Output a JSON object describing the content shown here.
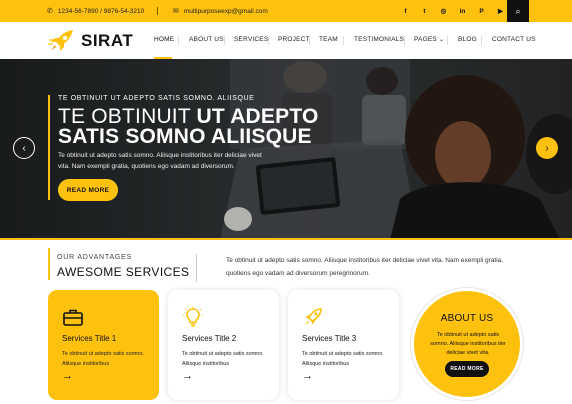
{
  "topbar": {
    "phone": "1234-56-7890 / 9876-54-3210",
    "email": "multipurposeexp@gmail.com",
    "phone_icon": "phone-icon",
    "email_icon": "envelope-icon",
    "social": [
      "f",
      "t",
      "◎",
      "in",
      "P",
      "▶"
    ],
    "social_names": [
      "facebook-icon",
      "twitter-icon",
      "instagram-icon",
      "linkedin-icon",
      "pinterest-icon",
      "youtube-icon"
    ],
    "search_icon": "search-icon"
  },
  "header": {
    "logo_text": "SIRAT",
    "logo_icon": "rocket-icon",
    "nav": [
      "HOME",
      "ABOUT US",
      "SERVICES",
      "PROJECT",
      "TEAM",
      "TESTIMONIALS",
      "PAGES",
      "BLOG",
      "CONTACT US"
    ],
    "active": "HOME",
    "pages_caret": "chevron-down-icon"
  },
  "hero": {
    "kicker": "TE OBTINUIT UT ADEPTO SATIS SOMNO. ALIISQUE",
    "heading_light": "TE OBTINUIT",
    "heading_bold": "UT ADEPTO",
    "heading_line2": "SATIS SOMNO ALIISQUE",
    "description": "Te obtinuit ut adepto satis somno. Aliisque institoribus iter deliciae vivet vita. Nam exempli gratia, quotiens ego vadam ad diversorum.",
    "button": "READ MORE",
    "prev_icon": "chevron-left-icon",
    "next_icon": "chevron-right-icon"
  },
  "advantages": {
    "kicker": "OUR ADVANTAGES",
    "title": "AWESOME SERVICES",
    "text": "Te obtinuit ut adepto satis somno. Aliisque institoribus iter deliciae vivet vita. Nam exempli gratia, quotiens ego vadam ad diversorum peregrinorum."
  },
  "services": [
    {
      "title": "Services Title 1",
      "text": "Te obtinuit ut adepto satis somno. Aliisque institoribus",
      "icon": "briefcase-icon"
    },
    {
      "title": "Services Title 2",
      "text": "Te obtinuit ut adepto satis somno Aliisque institoribus",
      "icon": "lightbulb-icon"
    },
    {
      "title": "Services Title 3",
      "text": "Te obtinuit ut adepto satis somno Aliisque institoribus",
      "icon": "rocket-icon"
    }
  ],
  "service_arrow": "→",
  "about": {
    "title": "ABOUT US",
    "text": "Te obtinuit ut adepto satis somno. Aliisque institoribus iter deliciae vivet vita.",
    "button": "READ MORE"
  },
  "colors": {
    "accent": "#fec10e",
    "dark": "#111111"
  }
}
